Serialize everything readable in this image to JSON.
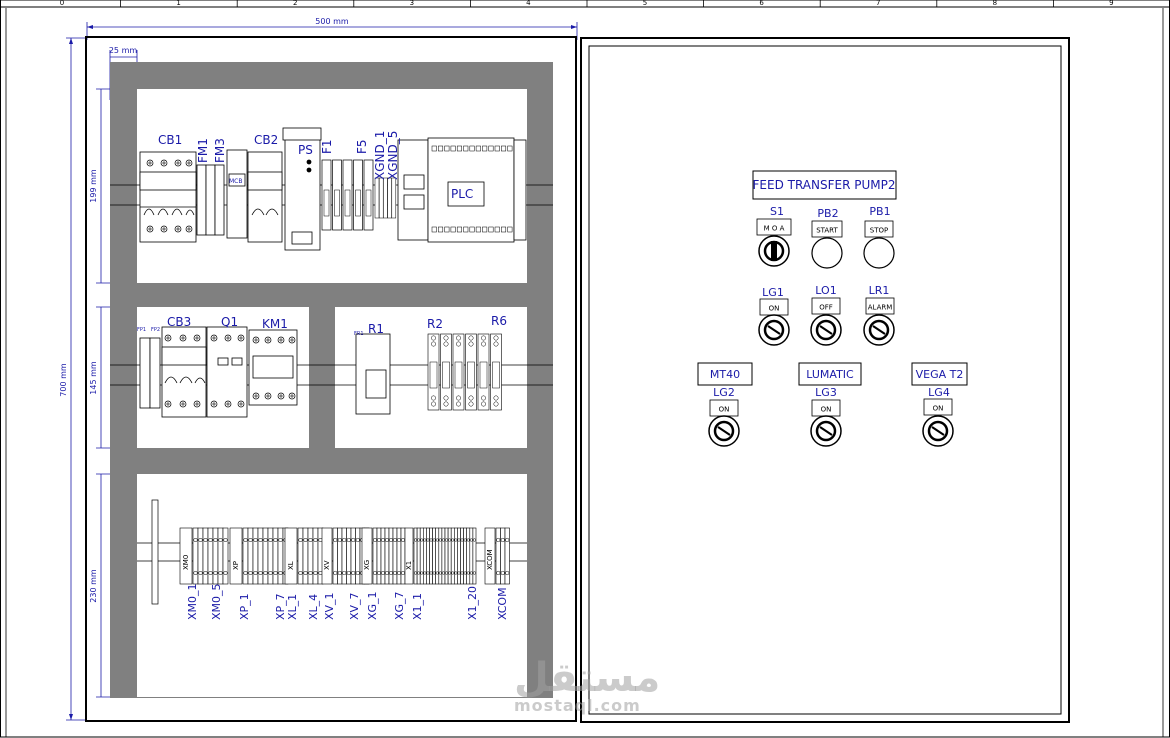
{
  "colors": {
    "ink": "#1a1aa8",
    "wall": "#808080",
    "line": "#000000"
  },
  "ruler": [
    "0",
    "1",
    "2",
    "3",
    "4",
    "5",
    "6",
    "7",
    "8",
    "9"
  ],
  "dims": {
    "width": "500 mm",
    "margin": "25 mm",
    "height": "700 mm",
    "row1": "199 mm",
    "row2": "145 mm",
    "row3": "230 mm"
  },
  "row1": {
    "cb1": "CB1",
    "fm1": "FM1",
    "fm3": "FM3",
    "mcb": "MCB",
    "cb2": "CB2",
    "ps": "PS",
    "f1": "F1",
    "f5": "F5",
    "xgnd1": "XGND_1",
    "xgnd5": "XGND_5",
    "plc": "PLC"
  },
  "row2": {
    "fp1": "FP1",
    "fp2": "FP2",
    "cb3": "CB3",
    "q1": "Q1",
    "km1": "KM1",
    "fr1": "FR1",
    "r1": "R1",
    "r2": "R2",
    "r6": "R6"
  },
  "terminals": {
    "groups": [
      "XM0",
      "XP",
      "XL",
      "XV",
      "XG",
      "X1",
      "XCOM"
    ],
    "labels": [
      "XM0_1",
      "XM0_5",
      "XP_1",
      "XP_7",
      "XL_1",
      "XL_4",
      "XV_1",
      "XV_7",
      "XG_1",
      "XG_7",
      "X1_1",
      "X1_20",
      "XCOM"
    ]
  },
  "door": {
    "title": "FEED TRANSFER PUMP2",
    "s1": {
      "tag": "S1",
      "plate": "M O A"
    },
    "pb2": {
      "tag": "PB2",
      "plate": "START"
    },
    "pb1": {
      "tag": "PB1",
      "plate": "STOP"
    },
    "lg1": {
      "tag": "LG1",
      "plate": "ON"
    },
    "lo1": {
      "tag": "LO1",
      "plate": "OFF"
    },
    "lr1": {
      "tag": "LR1",
      "plate": "ALARM"
    },
    "mt40": "MT40",
    "lumatic": "LUMATIC",
    "vega": "VEGA T2",
    "lg2": {
      "tag": "LG2",
      "plate": "ON"
    },
    "lg3": {
      "tag": "LG3",
      "plate": "ON"
    },
    "lg4": {
      "tag": "LG4",
      "plate": "ON"
    }
  },
  "watermark": {
    "arabic": "مستقل",
    "latin": "mostaql.com"
  }
}
